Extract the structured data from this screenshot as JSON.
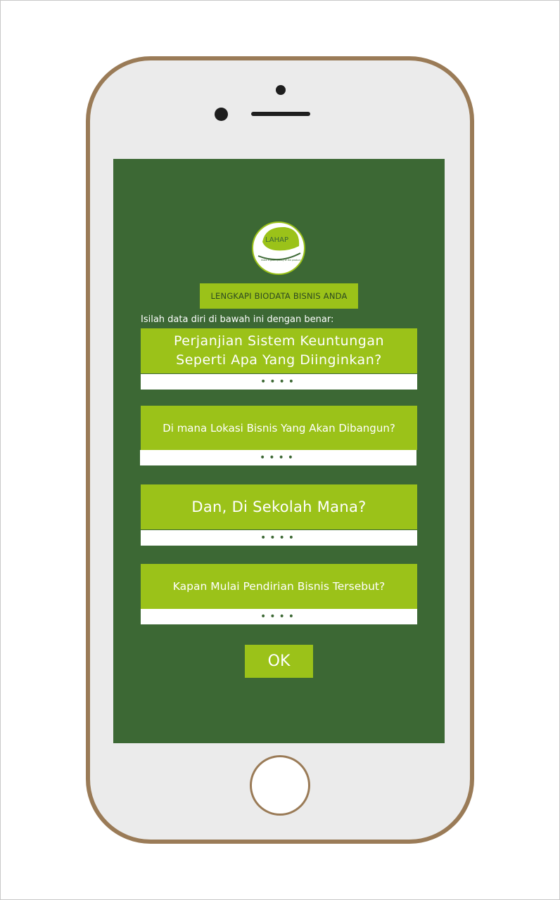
{
  "logo": {
    "brand": "LAHAP",
    "tagline": "make a good quality of the product"
  },
  "form": {
    "header": "LENGKAPI BIODATA BISNIS ANDA",
    "instruction": "Isilah data diri di bawah ini dengan benar:",
    "questions": [
      {
        "lines": [
          "Perjanjian Sistem Keuntungan",
          "Seperti Apa Yang Diinginkan?"
        ],
        "answer": "••••"
      },
      {
        "lines": [
          "Di mana Lokasi Bisnis Yang Akan Dibangun?"
        ],
        "answer": "••••"
      },
      {
        "lines": [
          "Dan, Di Sekolah Mana?"
        ],
        "answer": "••••"
      },
      {
        "lines": [
          "Kapan Mulai Pendirian Bisnis Tersebut?"
        ],
        "answer": "••••"
      }
    ],
    "ok_label": "OK"
  },
  "colors": {
    "screen_bg": "#3c6834",
    "accent": "#9bc219",
    "phone_frame": "#9a7b57",
    "phone_body": "#ebebeb"
  }
}
